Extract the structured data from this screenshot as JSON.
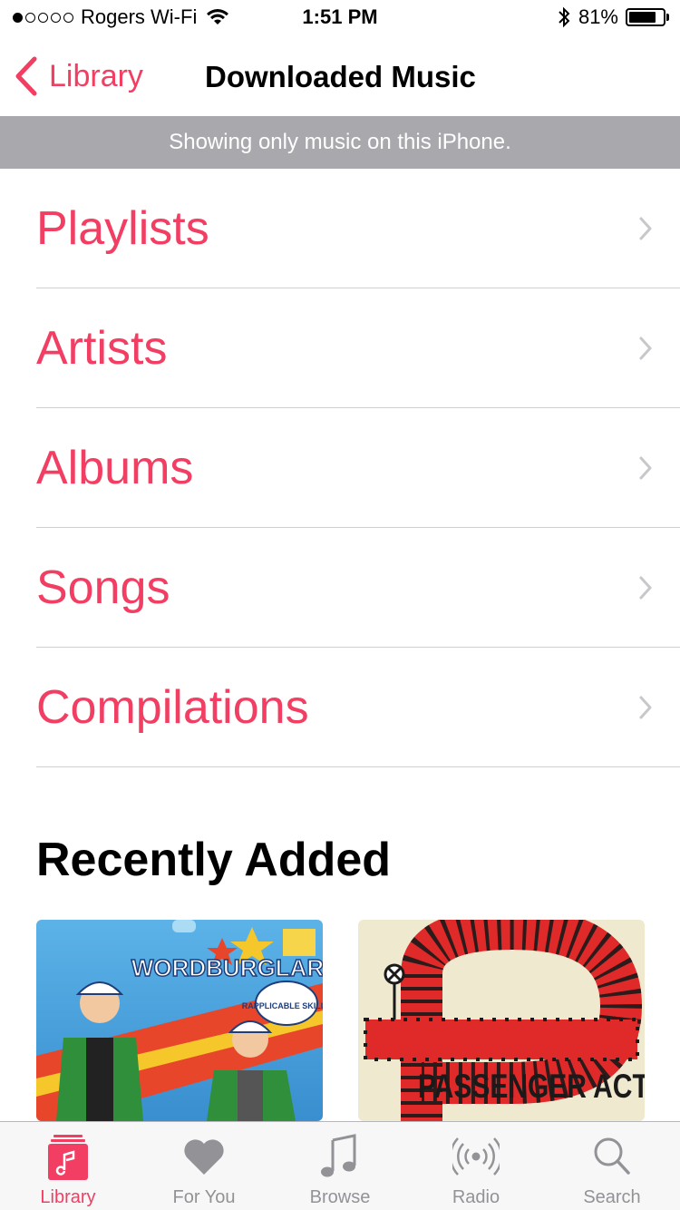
{
  "status_bar": {
    "carrier": "Rogers Wi-Fi",
    "signal_bars_filled": 1,
    "signal_bars_total": 5,
    "time": "1:51 PM",
    "battery_percent_label": "81%",
    "battery_level": 0.81
  },
  "nav": {
    "back_label": "Library",
    "title": "Downloaded Music"
  },
  "banner": {
    "text": "Showing only music on this iPhone."
  },
  "library_items": [
    {
      "label": "Playlists"
    },
    {
      "label": "Artists"
    },
    {
      "label": "Albums"
    },
    {
      "label": "Songs"
    },
    {
      "label": "Compilations"
    }
  ],
  "recently_added": {
    "title": "Recently Added",
    "albums": [
      {
        "art_lettering": "WORDBURGLAR",
        "art_sub_lettering": "RAPPLICABLE SKILLS"
      },
      {
        "art_lettering": "PASSENGER ACTION"
      }
    ]
  },
  "tab_bar": {
    "tabs": [
      {
        "label": "Library",
        "icon": "library-icon",
        "active": true
      },
      {
        "label": "For You",
        "icon": "heart-icon",
        "active": false
      },
      {
        "label": "Browse",
        "icon": "music-note-icon",
        "active": false
      },
      {
        "label": "Radio",
        "icon": "radio-icon",
        "active": false
      },
      {
        "label": "Search",
        "icon": "search-icon",
        "active": false
      }
    ]
  },
  "colors": {
    "accent": "#f23e62",
    "banner_bg": "#a9a9ad",
    "tab_inactive": "#929297"
  }
}
